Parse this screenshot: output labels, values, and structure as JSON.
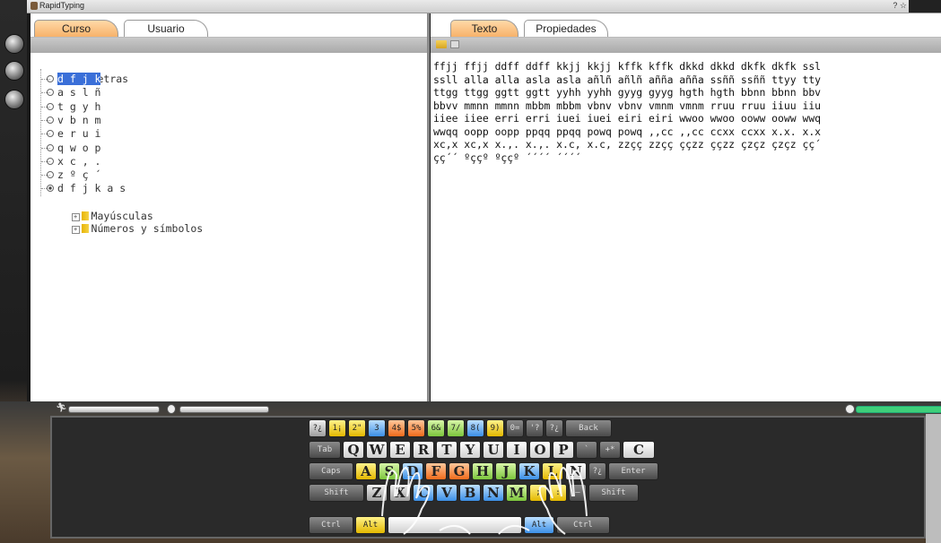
{
  "app": {
    "title": "RapidTyping",
    "help_label": "? ☆"
  },
  "left_panel": {
    "tabs": [
      {
        "label": "Curso",
        "active": true
      },
      {
        "label": "Usuario",
        "active": false
      }
    ],
    "tree": {
      "root": "Letras",
      "lessons": [
        {
          "label": "d f j k",
          "selected": true,
          "checked": false
        },
        {
          "label": "a s l ñ",
          "selected": false,
          "checked": false
        },
        {
          "label": "t g y h",
          "selected": false,
          "checked": false
        },
        {
          "label": "v b n m",
          "selected": false,
          "checked": false
        },
        {
          "label": "e r u i",
          "selected": false,
          "checked": false
        },
        {
          "label": "q w o p",
          "selected": false,
          "checked": false
        },
        {
          "label": "x c , .",
          "selected": false,
          "checked": false
        },
        {
          "label": "z º ç ´",
          "selected": false,
          "checked": false
        },
        {
          "label": "d f j k a s",
          "selected": false,
          "checked": true
        }
      ],
      "groups": [
        "Mayúsculas",
        "Números y símbolos"
      ]
    }
  },
  "right_panel": {
    "tabs": [
      {
        "label": "Texto",
        "active": true
      },
      {
        "label": "Propiedades",
        "active": false
      }
    ],
    "text_lines": [
      "ffjj ffjj ddff ddff kkjj kkjj kffk kffk dkkd dkkd dkfk dkfk ssl",
      "ssll alla alla asla asla añlñ añlñ aññа aññа ssññ ssññ ttyy tty",
      "ttgg ttgg ggtt ggtt yyhh yyhh gyyg gyyg hgth hgth bbnn bbnn bbv",
      "bbvv mmnn mmnn mbbm mbbm vbnv vbnv vmnm vmnm rruu rruu iiuu iiu",
      "iiee iiee erri erri iuei iuei eiri eiri wwoo wwoo ooww ooww wwq",
      "wwqq oopp oopp ppqq ppqq powq powq ,,cc ,,cc ccxx ccxx x.x. x.x",
      "xc,x xc,x x.,. x.,. x.c, x.c, zzçç zzçç ççzz ççzz çzçz çzçz çç´",
      "çç´´ ºççº ºççº ´´´´ ´´´´"
    ]
  },
  "keyboard": {
    "row1": [
      {
        "label": "?¿",
        "color": "gray"
      },
      {
        "label": "1¡",
        "color": "yellow"
      },
      {
        "label": "2\"",
        "color": "yellow"
      },
      {
        "label": "3",
        "color": "blue"
      },
      {
        "label": "4$",
        "color": "orange"
      },
      {
        "label": "5%",
        "color": "orange"
      },
      {
        "label": "6&",
        "color": "green"
      },
      {
        "label": "7/",
        "color": "green"
      },
      {
        "label": "8(",
        "color": "blue"
      },
      {
        "label": "9)",
        "color": "yellow"
      },
      {
        "label": "0=",
        "color": "dark"
      },
      {
        "label": "'?",
        "color": "dark"
      },
      {
        "label": "?¿",
        "color": "dark"
      },
      {
        "label": "Back",
        "color": "dark"
      }
    ],
    "row2": [
      {
        "label": "Tab",
        "color": "dark"
      },
      {
        "label": "Q",
        "color": "white"
      },
      {
        "label": "W",
        "color": "white"
      },
      {
        "label": "E",
        "color": "white"
      },
      {
        "label": "R",
        "color": "white"
      },
      {
        "label": "T",
        "color": "white"
      },
      {
        "label": "Y",
        "color": "white"
      },
      {
        "label": "U",
        "color": "white"
      },
      {
        "label": "I",
        "color": "white"
      },
      {
        "label": "O",
        "color": "white"
      },
      {
        "label": "P",
        "color": "white"
      },
      {
        "label": "`",
        "color": "dark"
      },
      {
        "label": "+*",
        "color": "dark"
      },
      {
        "label": "C",
        "color": "white"
      }
    ],
    "row3": [
      {
        "label": "Caps",
        "color": "dark"
      },
      {
        "label": "A",
        "color": "yellow"
      },
      {
        "label": "S",
        "color": "green"
      },
      {
        "label": "D",
        "color": "blue"
      },
      {
        "label": "F",
        "color": "orange"
      },
      {
        "label": "G",
        "color": "orange"
      },
      {
        "label": "H",
        "color": "green"
      },
      {
        "label": "J",
        "color": "green"
      },
      {
        "label": "K",
        "color": "blue"
      },
      {
        "label": "L",
        "color": "yellow"
      },
      {
        "label": "N",
        "color": "white"
      },
      {
        "label": "?¿",
        "color": "dark"
      },
      {
        "label": "Enter",
        "color": "dark"
      }
    ],
    "row4": [
      {
        "label": "Shift",
        "color": "dark"
      },
      {
        "label": "Z",
        "color": "gray"
      },
      {
        "label": "X",
        "color": "gray"
      },
      {
        "label": "C",
        "color": "blue"
      },
      {
        "label": "V",
        "color": "blue"
      },
      {
        "label": "B",
        "color": "blue"
      },
      {
        "label": "N",
        "color": "blue"
      },
      {
        "label": "M",
        "color": "green"
      },
      {
        "label": ";",
        "color": "yellow"
      },
      {
        "label": ":",
        "color": "yellow"
      },
      {
        "label": "—",
        "color": "dark"
      },
      {
        "label": "Shift",
        "color": "dark"
      }
    ],
    "row5": [
      {
        "label": "Ctrl",
        "color": "dark"
      },
      {
        "label": "Alt",
        "color": "yellow"
      },
      {
        "label": "",
        "color": "space"
      },
      {
        "label": "Alt",
        "color": "blue"
      },
      {
        "label": "Ctrl",
        "color": "dark"
      }
    ]
  },
  "colors": {
    "accent_tab": "#f7b26a",
    "selection": "#3a6fd8",
    "progress": "#3fd07a"
  }
}
